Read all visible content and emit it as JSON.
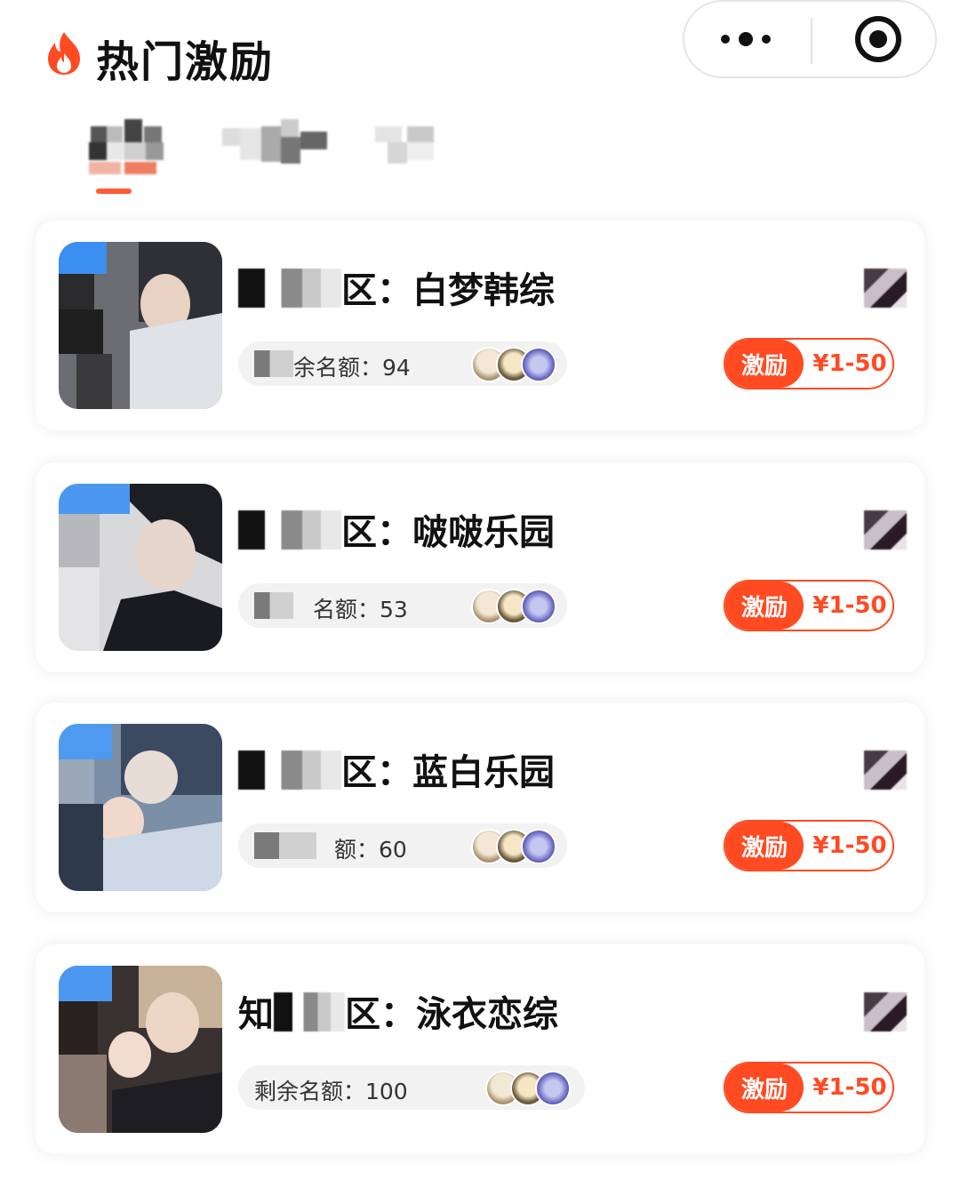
{
  "header": {
    "title": "热门激励",
    "flame_icon": "flame-icon",
    "capsule": {
      "more_icon": "more-dots-icon",
      "close_icon": "target-icon"
    }
  },
  "accent_color": "#ff4a22",
  "tabs": {
    "active_index": 0
  },
  "cards": [
    {
      "title_suffix": "区：白梦韩综",
      "quota_text": "余名额：94",
      "incentive_label": "激励",
      "incentive_price": "¥1-50"
    },
    {
      "title_suffix": "区：啵啵乐园",
      "quota_text": "名额：53",
      "incentive_label": "激励",
      "incentive_price": "¥1-50"
    },
    {
      "title_suffix": "区：蓝白乐园",
      "quota_text": "额：60",
      "incentive_label": "激励",
      "incentive_price": "¥1-50"
    },
    {
      "title_prefix": "知",
      "title_suffix": "区：泳衣恋综",
      "quota_text": "剩余名额：100",
      "incentive_label": "激励",
      "incentive_price": "¥1-50"
    }
  ]
}
